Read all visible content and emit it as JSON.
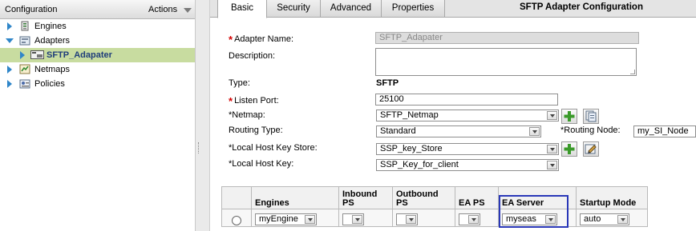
{
  "tree": {
    "header_title": "Configuration",
    "actions_label": "Actions",
    "items": [
      {
        "label": "Engines"
      },
      {
        "label": "Adapters"
      },
      {
        "label": "SFTP_Adapater"
      },
      {
        "label": "Netmaps"
      },
      {
        "label": "Policies"
      }
    ]
  },
  "tabs": [
    {
      "label": "Basic"
    },
    {
      "label": "Security"
    },
    {
      "label": "Advanced"
    },
    {
      "label": "Properties"
    }
  ],
  "panel_title": "SFTP Adapter Configuration",
  "form": {
    "adapter_name_label": "Adapter Name:",
    "adapter_name_value": "SFTP_Adapater",
    "description_label": "Description:",
    "type_label": "Type:",
    "type_value": "SFTP",
    "listen_port_label": "Listen Port:",
    "listen_port_value": "25100",
    "netmap_label": "*Netmap:",
    "netmap_value": "SFTP_Netmap",
    "routing_type_label": "Routing Type:",
    "routing_type_value": "Standard",
    "routing_node_label": "*Routing Node:",
    "routing_node_value": "my_SI_Node",
    "local_host_key_store_label": "*Local Host Key Store:",
    "local_host_key_store_value": "SSP_key_Store",
    "local_host_key_label": "*Local Host Key:",
    "local_host_key_value": "SSP_Key_for_client"
  },
  "engines_table": {
    "headers": [
      "Engines",
      "Inbound PS",
      "Outbound PS",
      "EA PS",
      "EA Server",
      "Startup Mode"
    ],
    "row": {
      "engine": "myEngine",
      "inbound_ps": "",
      "outbound_ps": "",
      "ea_ps": "",
      "ea_server": "myseas",
      "startup_mode": "auto"
    }
  },
  "colors": {
    "selection_bg": "#c8dca0",
    "required_star": "#d40000",
    "highlight_box": "#2a38b8",
    "add_icon": "#3a9a2a"
  }
}
